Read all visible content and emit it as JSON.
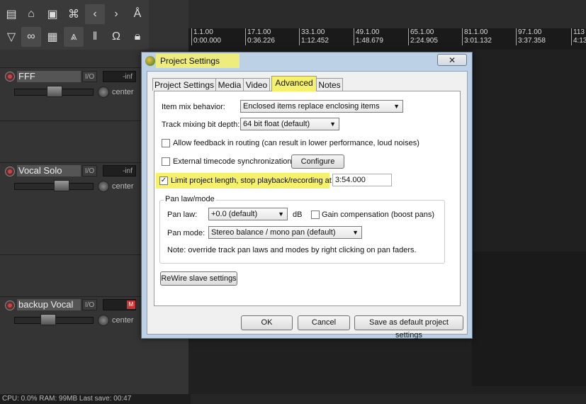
{
  "toolbar": {
    "row1_icons": [
      "new-project-icon",
      "open-project-icon",
      "save-project-icon",
      "attach-icon",
      "back-icon",
      "forward-icon",
      "metronome-icon"
    ],
    "row2_icons": [
      "trim-icon",
      "link-icon",
      "grid-icon",
      "ripple-icon",
      "snap-icon",
      "magnet-icon",
      "lock-icon"
    ]
  },
  "tracks": [
    {
      "name": "FFF",
      "io": "I/O",
      "meter": "-inf",
      "pan": "center",
      "muted": false
    },
    {
      "name": "Vocal Solo",
      "io": "I/O",
      "meter": "-inf",
      "pan": "center",
      "muted": false
    },
    {
      "name": "backup Vocal",
      "io": "I/O",
      "meter": "M",
      "pan": "center",
      "muted": true
    }
  ],
  "timeline": {
    "ticks": [
      {
        "bar": "1.1.00",
        "time": "0:00.000"
      },
      {
        "bar": "17.1.00",
        "time": "0:36.226"
      },
      {
        "bar": "33.1.00",
        "time": "1:12.452"
      },
      {
        "bar": "49.1.00",
        "time": "1:48.679"
      },
      {
        "bar": "65.1.00",
        "time": "2:24.905"
      },
      {
        "bar": "81.1.00",
        "time": "3:01.132"
      },
      {
        "bar": "97.1.00",
        "time": "3:37.358"
      },
      {
        "bar": "113",
        "time": "4:13"
      }
    ]
  },
  "status": {
    "text": "CPU: 0.0%  RAM: 99MB  Last save: 00:47"
  },
  "dialog": {
    "title": "Project Settings",
    "close": "✕",
    "tabs": [
      "Project Settings",
      "Media",
      "Video",
      "Advanced",
      "Notes"
    ],
    "active_tab": "Advanced",
    "item_mix_label": "Item mix behavior:",
    "item_mix_value": "Enclosed items replace enclosing items",
    "bit_depth_label": "Track mixing bit depth:",
    "bit_depth_value": "64 bit float (default)",
    "allow_feedback": "Allow feedback in routing (can result in lower performance, loud noises)",
    "allow_feedback_checked": false,
    "ext_timecode": "External timecode synchronization",
    "ext_timecode_checked": false,
    "configure": "Configure",
    "limit_length": "Limit project length, stop playback/recording at:",
    "limit_length_checked": true,
    "limit_value": "3:54.000",
    "pan_group": "Pan law/mode",
    "pan_law_label": "Pan law:",
    "pan_law_value": "+0.0 (default)",
    "db": "dB",
    "gain_comp": "Gain compensation (boost pans)",
    "gain_comp_checked": false,
    "pan_mode_label": "Pan mode:",
    "pan_mode_value": "Stereo balance / mono pan (default)",
    "pan_note": "Note: override track pan laws and modes by right clicking on pan faders.",
    "rewire": "ReWire slave settings",
    "ok": "OK",
    "cancel": "Cancel",
    "save_default": "Save as default project settings"
  }
}
